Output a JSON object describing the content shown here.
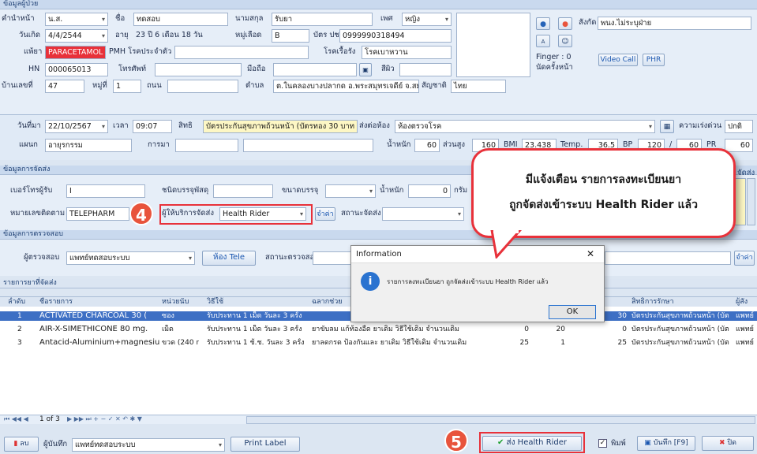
{
  "patient": {
    "section_title": "ข้อมูลผู้ป่วย",
    "prefix_label": "คำนำหน้า",
    "prefix": "น.ส.",
    "fname_label": "ชื่อ",
    "fname": "ทดสอบ",
    "lname_label": "นามสกุล",
    "lname": "รับยา",
    "sex_label": "เพศ",
    "sex": "หญิง",
    "dob_label": "วันเกิด",
    "dob": "4/4/2544",
    "age_label": "อายุ",
    "age": "23 ปี 6 เดือน 18 วัน",
    "blood_label": "หมู่เลือด",
    "blood": "B",
    "idcard_label": "บัตร ปชช.",
    "idcard": "0999990318494",
    "allergy_label": "แพ้ยา",
    "allergy": "PARACETAMOL",
    "pmh_label": "PMH โรคประจำตัว",
    "pmh": "",
    "chronic_label": "โรคเรื้อรัง",
    "chronic": "โรคเบาหวาน",
    "hn_label": "HN",
    "hn": "000065013",
    "phone_label": "โทรศัพท์",
    "phone": "",
    "mobile_label": "มือถือ",
    "mobile": "",
    "skin_label": "สีผิว",
    "skin": "",
    "house_label": "บ้านเลขที่",
    "house": "47",
    "moo_label": "หมู่ที่",
    "moo": "1",
    "road_label": "ถนน",
    "road": "",
    "tambon_label": "ตำบล",
    "tambon": "ต.ในคลองบางปลากด อ.พระสมุทรเจดีย์ จ.สมุท",
    "nation_label": "สัญชาติ",
    "nation": "ไทย",
    "dept_label": "สังกัด",
    "dept": "พนง.ไม่ระบุฝ่าย",
    "finger": "Finger : 0",
    "appt": "นัดครั้งหน้า",
    "videocall": "Video Call",
    "phr": "PHR"
  },
  "visit": {
    "date_label": "วันที่มา",
    "date": "22/10/2567",
    "time_label": "เวลา",
    "time": "09:07",
    "right_label": "สิทธิ",
    "right": "บัตรประกันสุขภาพถ้วนหน้า (บัตรทอง 30 บาท",
    "sendto_label": "ส่งต่อห้อง",
    "sendto": "ห้องตรวจโรค",
    "urgency_label": "ความเร่งด่วน",
    "urgency": "ปกติ",
    "dep_label": "แผนก",
    "dep": "อายุรกรรม",
    "disease_label": "การมา",
    "disease": "",
    "weight_label": "น้ำหนัก",
    "weight": "60",
    "height_label": "ส่วนสูง",
    "height": "160",
    "bmi_label": "BMI",
    "bmi": "23.438",
    "temp_label": "Temp.",
    "temp": "36.5",
    "bp_label": "BP",
    "bp1": "120",
    "bp_sep": "/",
    "bp2": "60",
    "pr_label": "PR",
    "pr": "60"
  },
  "delivery": {
    "section_title": "ข้อมูลการจัดส่ง",
    "receiver_label": "เบอร์โทรผู้รับ",
    "receiver": "I",
    "pkg_type_label": "ชนิดบรรจุพัสดุ",
    "pkg_type": "",
    "pkg_size_label": "ขนาดบรรจุ",
    "pkg_size": "",
    "weight_label": "น้ำหนัก",
    "weight": "0",
    "gram_label": "กรัม",
    "tracking_label": "หมายเลขติดตาม",
    "tracking": "TELEPHARM",
    "provider_label": "ผู้ให้บริการจัดส่ง",
    "provider": "Health Rider",
    "price_btn": "จำค่า",
    "status_label": "สถานะจัดส่ง",
    "status": "",
    "right_label": "จัดส่ง"
  },
  "exam": {
    "section_title": "ข้อมูลการตรวจสอบ",
    "examiner_label": "ผู้ตรวจสอบ",
    "examiner": "แพทย์ทดสอบระบบ",
    "tele_btn": "ห้อง Tele",
    "status_label": "สถานะตรวจสอบ",
    "save_btn": "จำค่า"
  },
  "druglist": {
    "section_title": "รายการยาที่จัดส่ง",
    "headers": [
      "ลำดับ",
      "ชื่อรายการ",
      "หน่วยนับ",
      "วิธีใช้",
      "ฉลากช่วย",
      "",
      "",
      "สิทธิการรักษา",
      "ผู้สั่ง"
    ],
    "rows": [
      {
        "no": "1",
        "name": "ACTIVATED CHARCOAL 30 (",
        "unit": "ซอง",
        "usage": "รับประทาน 1 เม็ด วันละ 3 ครั้ง",
        "label": "",
        "qty": "",
        "q2": "",
        "price": "30",
        "right": "บัตรประกันสุขภาพถ้วนหน้า (บัต",
        "doctor": "แพทย์"
      },
      {
        "no": "2",
        "name": "AIR-X-SIMETHICONE 80 mg.",
        "unit": "เม็ด",
        "usage": "รับประทาน 1 เม็ด วันละ 3 ครั้ง",
        "label": "ยาขับลม แก้ท้องอืด ยาเดิม วิธีใช้เดิม จำนวนเดิม",
        "qty": "0",
        "q2": "20",
        "price": "0",
        "right": "บัตรประกันสุขภาพถ้วนหน้า (บัต",
        "doctor": "แพทย์"
      },
      {
        "no": "3",
        "name": "Antacid-Aluminium+magnesiu",
        "unit": "ขวด (240 r",
        "usage": "รับประทาน 1 ช้.ช. วันละ 3 ครั้ง",
        "label": "ยาลดกรด ป้องกันและ ยาเดิม วิธีใช้เดิม จำนวนเดิม",
        "qty": "25",
        "q2": "1",
        "price": "25",
        "right": "บัตรประกันสุขภาพถ้วนหน้า (บัต",
        "doctor": "แพทย์"
      }
    ],
    "pager": "1 of 3"
  },
  "footer": {
    "delete_btn": "ลบ",
    "recorder_label": "ผู้บันทึก",
    "recorder": "แพทย์ทดสอบระบบ",
    "print_btn": "Print Label",
    "send_btn": "ส่ง Health Rider",
    "print_chk": "พิมพ์",
    "save_btn": "บันทึก [F9]",
    "close_btn": "ปิด"
  },
  "dialog": {
    "title": "Information",
    "message": "รายการลงทะเบียนยา ถูกจัดส่งเข้าระบบ Health Rider แล้ว",
    "ok": "OK",
    "close": "✕"
  },
  "callout": {
    "line1": "มีแจ้งเตือน รายการลงทะเบียนยา",
    "line2": "ถูกจัดส่งเข้าระบบ Health Rider แล้ว"
  },
  "steps": {
    "step4": "4",
    "step5": "5"
  },
  "colors": {
    "accent": "#e8313a",
    "header": "#c9d9ee",
    "selected": "#3d6fc4"
  }
}
